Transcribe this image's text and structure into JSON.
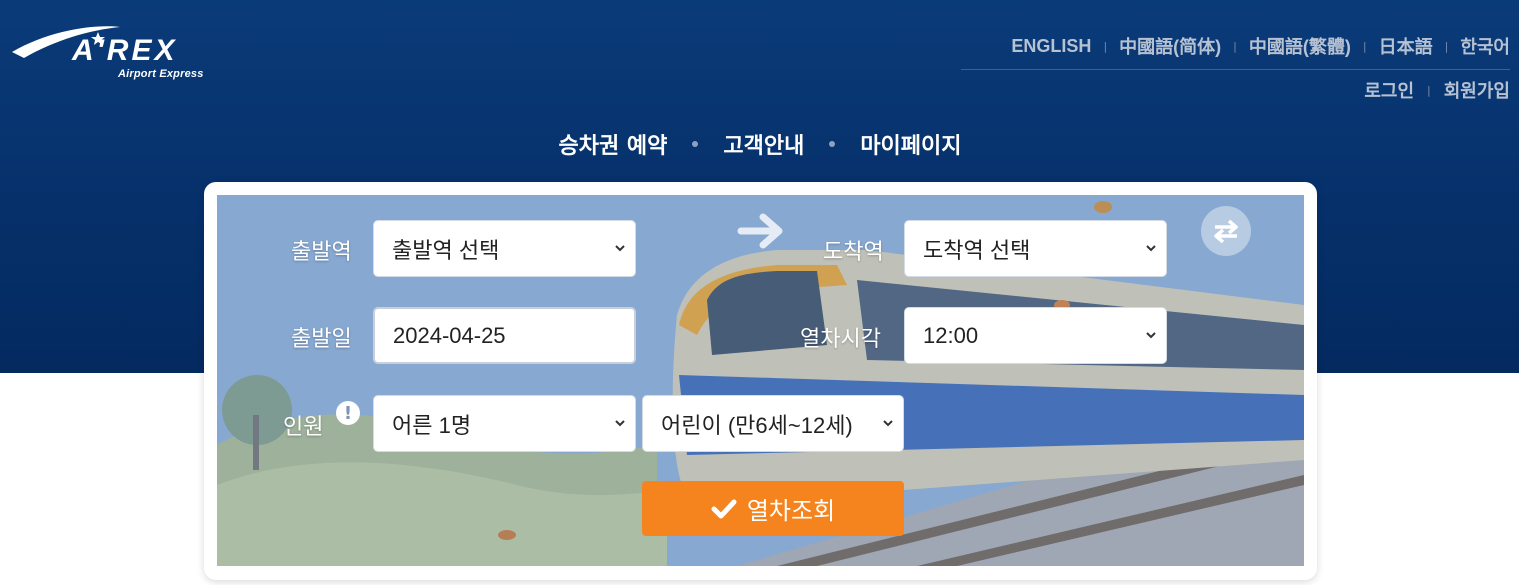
{
  "brand": {
    "logo_text": "A'REX",
    "logo_sub": "Airport Express"
  },
  "languages": [
    "ENGLISH",
    "中國語(简体)",
    "中國語(繁體)",
    "日本語",
    "한국어"
  ],
  "user_menu": {
    "login": "로그인",
    "signup": "회원가입"
  },
  "main_nav": [
    "승차권 예약",
    "고객안내",
    "마이페이지"
  ],
  "booking_form": {
    "departure_label": "출발역",
    "departure_value": "출발역 선택",
    "arrival_label": "도착역",
    "arrival_value": "도착역 선택",
    "date_label": "출발일",
    "date_value": "2024-04-25",
    "time_label": "열차시각",
    "time_value": "12:00",
    "passenger_label": "인원",
    "adult_value": "어른 1명",
    "child_value": "어린이 (만6세~12세)",
    "search_label": "열차조회"
  },
  "icons": {
    "arrow": "arrow-right-icon",
    "swap": "swap-icon",
    "info": "info-icon",
    "check": "check-icon",
    "caret": "chevron-down-icon"
  },
  "colors": {
    "header_bg": "#0a3b79",
    "accent_orange": "#f5841f",
    "nav_text": "#ffffff",
    "link_text": "#b6c1d2"
  }
}
